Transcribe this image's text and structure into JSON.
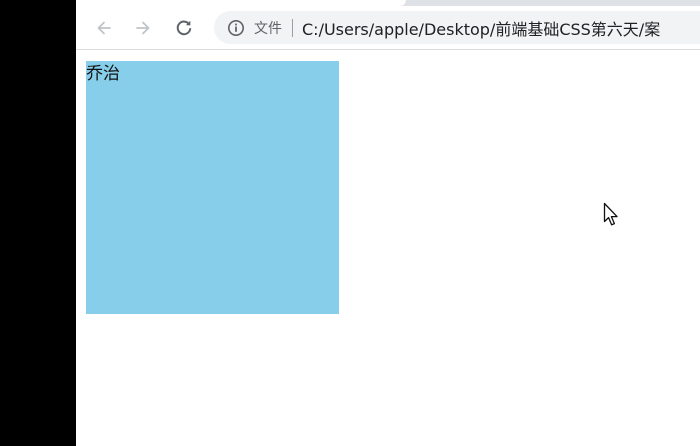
{
  "browser": {
    "toolbar": {
      "back_icon": "arrow-back-icon",
      "forward_icon": "arrow-forward-icon",
      "reload_icon": "reload-icon",
      "info_icon": "info-icon",
      "chip_label": "文件",
      "url": "C:/Users/apple/Desktop/前端基础CSS第六天/案"
    }
  },
  "page": {
    "box_text": "乔治",
    "box_color": "#87ceeb"
  },
  "pointer": {
    "icon": "mouse-cursor-icon"
  }
}
